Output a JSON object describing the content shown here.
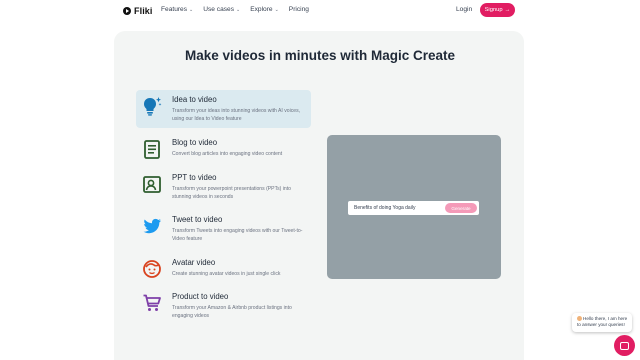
{
  "nav": {
    "logo_text": "Fliki",
    "links": [
      {
        "label": "Features",
        "has_dropdown": true
      },
      {
        "label": "Use cases",
        "has_dropdown": true
      },
      {
        "label": "Explore",
        "has_dropdown": true
      },
      {
        "label": "Pricing",
        "has_dropdown": false
      }
    ],
    "login_label": "Login",
    "signup_label": "Signup",
    "signup_arrow": "→",
    "chevron": "⌄",
    "accent_color": "#e11d62"
  },
  "main": {
    "title": "Make videos in minutes with Magic Create",
    "items": [
      {
        "title": "Idea to video",
        "desc": "Transform your ideas into stunning videos with AI voices, using our Idea to Video feature",
        "icon": "lightbulb-icon",
        "selected": true
      },
      {
        "title": "Blog to video",
        "desc": "Convert blog articles into engaging video content",
        "icon": "document-icon",
        "selected": false
      },
      {
        "title": "PPT to video",
        "desc": "Transform your powerpoint presentations (PPTs) into stunning videos in seconds",
        "icon": "presentation-icon",
        "selected": false
      },
      {
        "title": "Tweet to video",
        "desc": "Transform Tweets into engaging videos with our Tweet-to-Video feature",
        "icon": "twitter-bird-icon",
        "selected": false
      },
      {
        "title": "Avatar video",
        "desc": "Create stunning avatar videos in just single click",
        "icon": "avatar-face-icon",
        "selected": false
      },
      {
        "title": "Product to video",
        "desc": "Transform your Amazon & Airbnb product listings into engaging videos",
        "icon": "shopping-cart-icon",
        "selected": false
      }
    ]
  },
  "preview": {
    "prompt_text": "Benefits of doing Yoga daily",
    "generate_label": "Generate"
  },
  "chat": {
    "message": "Hello there, I am here to answer your queries!"
  }
}
